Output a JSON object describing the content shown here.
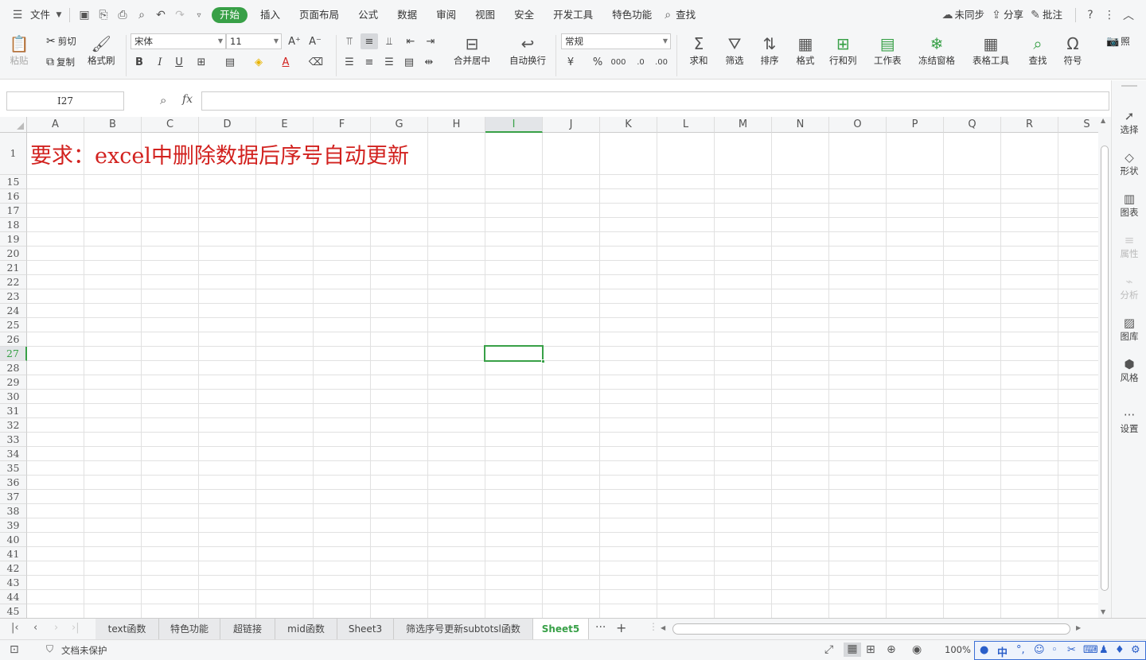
{
  "menubar": {
    "file_label": "文件",
    "tabs": [
      {
        "label": "开始",
        "active": true
      },
      {
        "label": "插入"
      },
      {
        "label": "页面布局"
      },
      {
        "label": "公式"
      },
      {
        "label": "数据"
      },
      {
        "label": "审阅"
      },
      {
        "label": "视图"
      },
      {
        "label": "安全"
      },
      {
        "label": "开发工具"
      },
      {
        "label": "特色功能"
      }
    ],
    "search_label": "查找",
    "sync_label": "未同步",
    "share_label": "分享",
    "comment_label": "批注"
  },
  "ribbon": {
    "paste": "粘贴",
    "cut": "剪切",
    "copy": "复制",
    "format_painter": "格式刷",
    "font_name": "宋体",
    "font_size": "11",
    "merge_center": "合并居中",
    "wrap_text": "自动换行",
    "number_format": "常规",
    "sum": "求和",
    "filter": "筛选",
    "sort": "排序",
    "format": "格式",
    "rows_cols": "行和列",
    "worksheet": "工作表",
    "freeze": "冻结窗格",
    "table_tools": "表格工具",
    "find": "查找",
    "symbol": "符号",
    "photo": "照"
  },
  "formula_bar": {
    "name_box": "I27",
    "fx": "fx",
    "value": ""
  },
  "grid": {
    "columns": [
      "A",
      "B",
      "C",
      "D",
      "E",
      "F",
      "G",
      "H",
      "I",
      "J",
      "K",
      "L",
      "M",
      "N",
      "O",
      "P",
      "Q",
      "R",
      "S"
    ],
    "selected_column": "I",
    "rows": [
      "1",
      "15",
      "16",
      "17",
      "18",
      "19",
      "20",
      "21",
      "22",
      "23",
      "24",
      "25",
      "26",
      "27",
      "28",
      "29",
      "30",
      "31",
      "32",
      "33",
      "34",
      "35",
      "36",
      "37",
      "38",
      "39",
      "40",
      "41",
      "42",
      "43",
      "44",
      "45"
    ],
    "selected_row": "27",
    "title_text": "要求：excel中删除数据后序号自动更新"
  },
  "right_panel": [
    {
      "label": "选择",
      "icon": "cursor-icon"
    },
    {
      "label": "形状",
      "icon": "shape-icon"
    },
    {
      "label": "图表",
      "icon": "chart-icon"
    },
    {
      "label": "属性",
      "icon": "properties-icon",
      "disabled": true
    },
    {
      "label": "分析",
      "icon": "analysis-icon",
      "disabled": true
    },
    {
      "label": "图库",
      "icon": "gallery-icon"
    },
    {
      "label": "风格",
      "icon": "style-icon"
    },
    {
      "label": "设置",
      "icon": "more-icon"
    }
  ],
  "sheets": [
    {
      "label": "text函数"
    },
    {
      "label": "特色功能"
    },
    {
      "label": "超链接"
    },
    {
      "label": "mid函数"
    },
    {
      "label": "Sheet3"
    },
    {
      "label": "筛选序号更新subtotsl函数"
    },
    {
      "label": "Sheet5",
      "active": true
    }
  ],
  "status": {
    "protect_label": "文档未保护",
    "zoom": "100%",
    "ime": "中"
  },
  "colors": {
    "accent": "#38a047",
    "title_red": "#d2221f"
  }
}
